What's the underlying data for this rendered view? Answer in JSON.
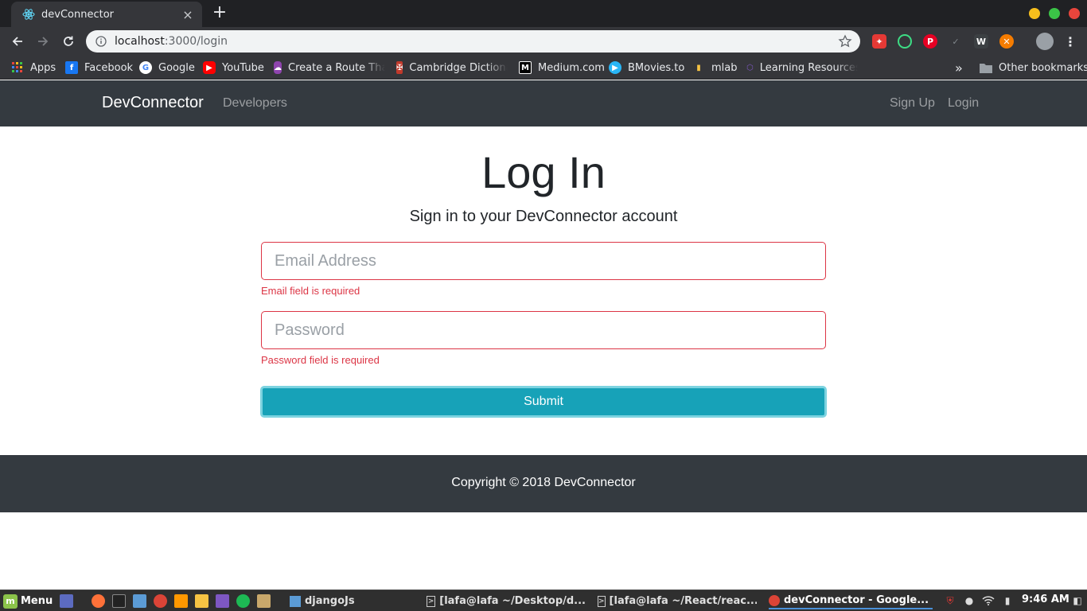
{
  "browser": {
    "tab_title": "devConnector",
    "new_tab": "+",
    "close": "×",
    "url_host": "localhost",
    "url_path": ":3000/login"
  },
  "bookmarks": [
    {
      "label": "Apps",
      "icon": "apps-grid-icon",
      "color": "#e8453c"
    },
    {
      "label": "Facebook",
      "icon": "facebook-icon",
      "color": "#1877f2"
    },
    {
      "label": "Google",
      "icon": "google-icon",
      "color": "#ffffff"
    },
    {
      "label": "YouTube",
      "icon": "youtube-icon",
      "color": "#ff0000"
    },
    {
      "label": "Create a Route That",
      "icon": "cloud-upload-icon",
      "color": "#8e44ad"
    },
    {
      "label": "Cambridge Dictiona",
      "icon": "cambridge-shield-icon",
      "color": "#c0392b"
    },
    {
      "label": "Medium.com",
      "icon": "medium-icon",
      "color": "#000000"
    },
    {
      "label": "BMovies.to",
      "icon": "play-icon",
      "color": "#29b6f6"
    },
    {
      "label": "mlab",
      "icon": "mlab-icon",
      "color": "#f6c343"
    },
    {
      "label": "Learning Resources",
      "icon": "graphql-icon",
      "color": "#7e57c2"
    }
  ],
  "bookmarks_overflow": "»",
  "other_bookmarks": "Other bookmarks",
  "navbar": {
    "brand": "DevConnector",
    "developers": "Developers",
    "signup": "Sign Up",
    "login": "Login"
  },
  "login": {
    "heading": "Log In",
    "lead": "Sign in to your DevConnector account",
    "email_placeholder": "Email Address",
    "email_error": "Email field is required",
    "password_placeholder": "Password",
    "password_error": "Password field is required",
    "submit": "Submit"
  },
  "footer": {
    "copyright": "Copyright © 2018 DevConnector"
  },
  "taskbar": {
    "menu": "Menu",
    "tasks": [
      {
        "label": "djangoJs",
        "icon": "folder-icon"
      },
      {
        "label": "[lafa@lafa ~/Desktop/d...",
        "icon": "terminal-icon"
      },
      {
        "label": "[lafa@lafa ~/React/reac...",
        "icon": "terminal-icon"
      },
      {
        "label": "devConnector - Google...",
        "icon": "chrome-icon"
      }
    ],
    "clock": "9:46 AM"
  },
  "colors": {
    "navbar_bg": "#343a40",
    "danger": "#dc3545",
    "info": "#17a2b8"
  }
}
